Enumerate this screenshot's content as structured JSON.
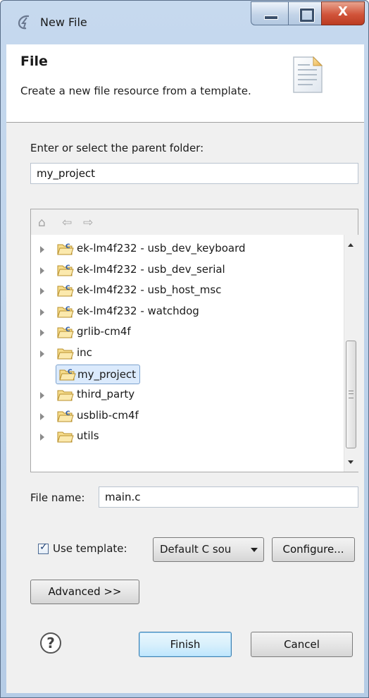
{
  "window": {
    "title": "New File"
  },
  "header": {
    "title": "File",
    "description": "Create a new file resource from a template."
  },
  "parent_folder": {
    "label": "Enter or select the parent folder:",
    "value": "my_project"
  },
  "tree": {
    "items": [
      {
        "label": "ek-lm4f232 - usb_dev_keyboard",
        "kind": "project",
        "expandable": true
      },
      {
        "label": "ek-lm4f232 - usb_dev_serial",
        "kind": "project",
        "expandable": true
      },
      {
        "label": "ek-lm4f232 - usb_host_msc",
        "kind": "project",
        "expandable": true
      },
      {
        "label": "ek-lm4f232 - watchdog",
        "kind": "project",
        "expandable": true
      },
      {
        "label": "grlib-cm4f",
        "kind": "project",
        "expandable": true
      },
      {
        "label": "inc",
        "kind": "folder",
        "expandable": true
      },
      {
        "label": "my_project",
        "kind": "project",
        "expandable": false,
        "selected": true
      },
      {
        "label": "third_party",
        "kind": "folder",
        "expandable": true
      },
      {
        "label": "usblib-cm4f",
        "kind": "project",
        "expandable": true
      },
      {
        "label": "utils",
        "kind": "folder",
        "expandable": true
      }
    ]
  },
  "file_name": {
    "label": "File name:",
    "value": "main.c"
  },
  "template": {
    "checkbox_label": "Use template:",
    "checked": true,
    "selected": "Default C sou",
    "configure_label": "Configure..."
  },
  "advanced_label": "Advanced >>",
  "footer": {
    "help_glyph": "?",
    "finish_label": "Finish",
    "cancel_label": "Cancel"
  },
  "icons": {
    "title": "eclipse-app-icon",
    "header": "new-file-document-icon",
    "toolbar": [
      "home-icon",
      "back-icon",
      "forward-icon"
    ]
  }
}
